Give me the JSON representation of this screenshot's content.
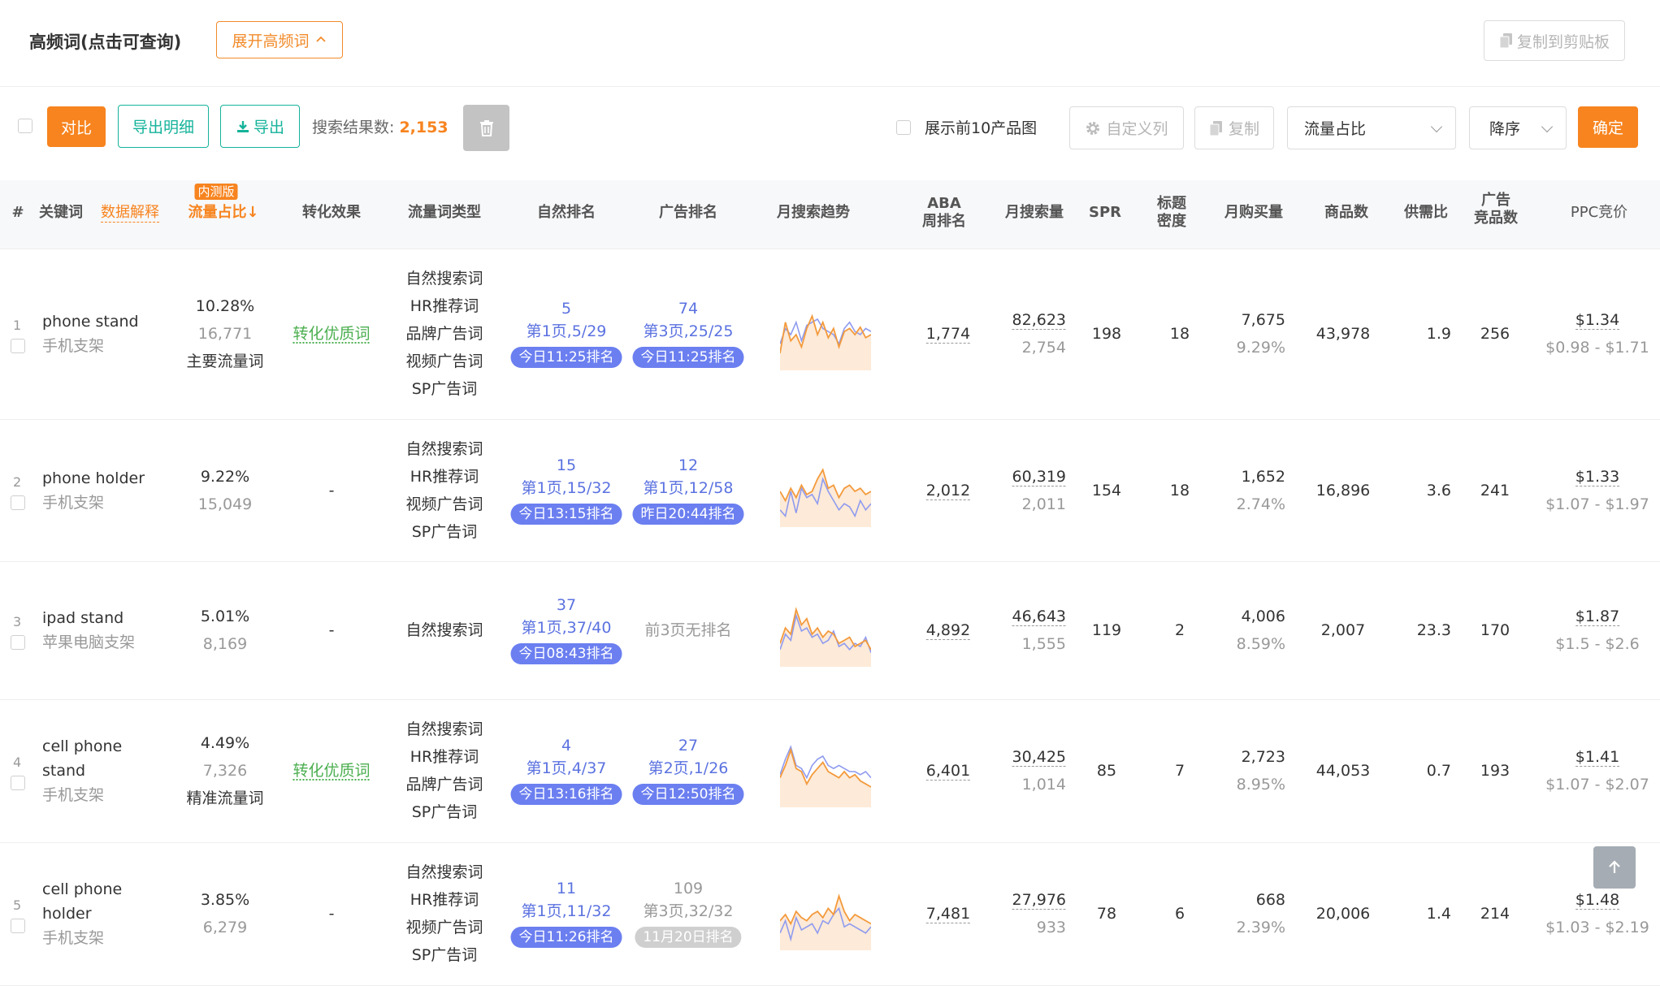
{
  "header": {
    "title": "高频词(点击可查询)",
    "expand_button": "展开高频词",
    "copy_clipboard": "复制到剪贴板"
  },
  "toolbar": {
    "compare": "对比",
    "export_detail": "导出明细",
    "export": "导出",
    "result_label": "搜索结果数:",
    "result_count": "2,153",
    "show_top10": "展示前10产品图",
    "custom_columns": "自定义列",
    "copy": "复制",
    "sort_field": "流量占比",
    "sort_order": "降序",
    "confirm": "确定"
  },
  "columns": {
    "index": "#",
    "keyword": "关键词",
    "data_explain": "数据解释",
    "beta_badge": "内测版",
    "traffic_share": "流量占比↓",
    "conversion": "转化效果",
    "traffic_type": "流量词类型",
    "natural_rank": "自然排名",
    "ad_rank": "广告排名",
    "trend": "月搜索趋势",
    "aba_rank_1": "ABA",
    "aba_rank_2": "周排名",
    "monthly_search": "月搜索量",
    "spr": "SPR",
    "title_density_1": "标题",
    "title_density_2": "密度",
    "monthly_purchase": "月购买量",
    "product_count": "商品数",
    "supply_demand": "供需比",
    "ad_products_1": "广告",
    "ad_products_2": "竞品数",
    "ppc": "PPC竞价"
  },
  "rows": [
    {
      "index": "1",
      "kw_lines": [
        "phone stand"
      ],
      "kw_cn": "手机支架",
      "share": "10.28%",
      "share_count": "16,771",
      "share_tag": "主要流量词",
      "conversion": "转化优质词",
      "types": [
        "自然搜索词",
        "HR推荐词",
        "品牌广告词",
        "视频广告词",
        "SP广告词"
      ],
      "nat_rank": "5",
      "nat_page": "第1页,5/29",
      "nat_time": "今日11:25排名",
      "ad_rank": "74",
      "ad_page": "第3页,25/25",
      "ad_time": "今日11:25排名",
      "aba": "1,774",
      "search": "82,623",
      "search_sub": "2,754",
      "spr": "198",
      "density": "18",
      "purchase": "7,675",
      "purchase_rate": "9.29%",
      "products": "43,978",
      "ratio": "1.9",
      "ad_products": "256",
      "ppc": "$1.34",
      "ppc_range": "$0.98 - $1.71"
    },
    {
      "index": "2",
      "kw_lines": [
        "phone holder"
      ],
      "kw_cn": "手机支架",
      "share": "9.22%",
      "share_count": "15,049",
      "share_tag": "",
      "conversion": "-",
      "types": [
        "自然搜索词",
        "HR推荐词",
        "视频广告词",
        "SP广告词"
      ],
      "nat_rank": "15",
      "nat_page": "第1页,15/32",
      "nat_time": "今日13:15排名",
      "ad_rank": "12",
      "ad_page": "第1页,12/58",
      "ad_time": "昨日20:44排名",
      "aba": "2,012",
      "search": "60,319",
      "search_sub": "2,011",
      "spr": "154",
      "density": "18",
      "purchase": "1,652",
      "purchase_rate": "2.74%",
      "products": "16,896",
      "ratio": "3.6",
      "ad_products": "241",
      "ppc": "$1.33",
      "ppc_range": "$1.07 - $1.97"
    },
    {
      "index": "3",
      "kw_lines": [
        "ipad stand"
      ],
      "kw_cn": "苹果电脑支架",
      "share": "5.01%",
      "share_count": "8,169",
      "share_tag": "",
      "conversion": "-",
      "types": [
        "自然搜索词"
      ],
      "nat_rank": "37",
      "nat_page": "第1页,37/40",
      "nat_time": "今日08:43排名",
      "ad_rank": "",
      "ad_page": "前3页无排名",
      "ad_time": "",
      "aba": "4,892",
      "search": "46,643",
      "search_sub": "1,555",
      "spr": "119",
      "density": "2",
      "purchase": "4,006",
      "purchase_rate": "8.59%",
      "products": "2,007",
      "ratio": "23.3",
      "ad_products": "170",
      "ppc": "$1.87",
      "ppc_range": "$1.5 - $2.6"
    },
    {
      "index": "4",
      "kw_lines": [
        "cell phone",
        "stand"
      ],
      "kw_cn": "手机支架",
      "share": "4.49%",
      "share_count": "7,326",
      "share_tag": "精准流量词",
      "conversion": "转化优质词",
      "types": [
        "自然搜索词",
        "HR推荐词",
        "品牌广告词",
        "SP广告词"
      ],
      "nat_rank": "4",
      "nat_page": "第1页,4/37",
      "nat_time": "今日13:16排名",
      "ad_rank": "27",
      "ad_page": "第2页,1/26",
      "ad_time": "今日12:50排名",
      "aba": "6,401",
      "search": "30,425",
      "search_sub": "1,014",
      "spr": "85",
      "density": "7",
      "purchase": "2,723",
      "purchase_rate": "8.95%",
      "products": "44,053",
      "ratio": "0.7",
      "ad_products": "193",
      "ppc": "$1.41",
      "ppc_range": "$1.07 - $2.07"
    },
    {
      "index": "5",
      "kw_lines": [
        "cell phone",
        "holder"
      ],
      "kw_cn": "手机支架",
      "share": "3.85%",
      "share_count": "6,279",
      "share_tag": "",
      "conversion": "-",
      "types": [
        "自然搜索词",
        "HR推荐词",
        "视频广告词",
        "SP广告词"
      ],
      "nat_rank": "11",
      "nat_page": "第1页,11/32",
      "nat_time": "今日11:26排名",
      "ad_rank": "109",
      "ad_page": "第3页,32/32",
      "ad_time": "11月20日排名",
      "aba": "7,481",
      "search": "27,976",
      "search_sub": "933",
      "spr": "78",
      "density": "6",
      "purchase": "668",
      "purchase_rate": "2.39%",
      "products": "20,006",
      "ratio": "1.4",
      "ad_products": "214",
      "ppc": "$1.48",
      "ppc_range": "$1.03 - $2.19"
    }
  ],
  "colors": {
    "accent": "#f7841f",
    "teal": "#14b39a",
    "rank_blue": "#5b72e0",
    "badge_blue": "#6b7ff0",
    "good_green": "#4caf50",
    "trend_orange": "#f39a3c",
    "trend_blue": "#8f9bef"
  }
}
